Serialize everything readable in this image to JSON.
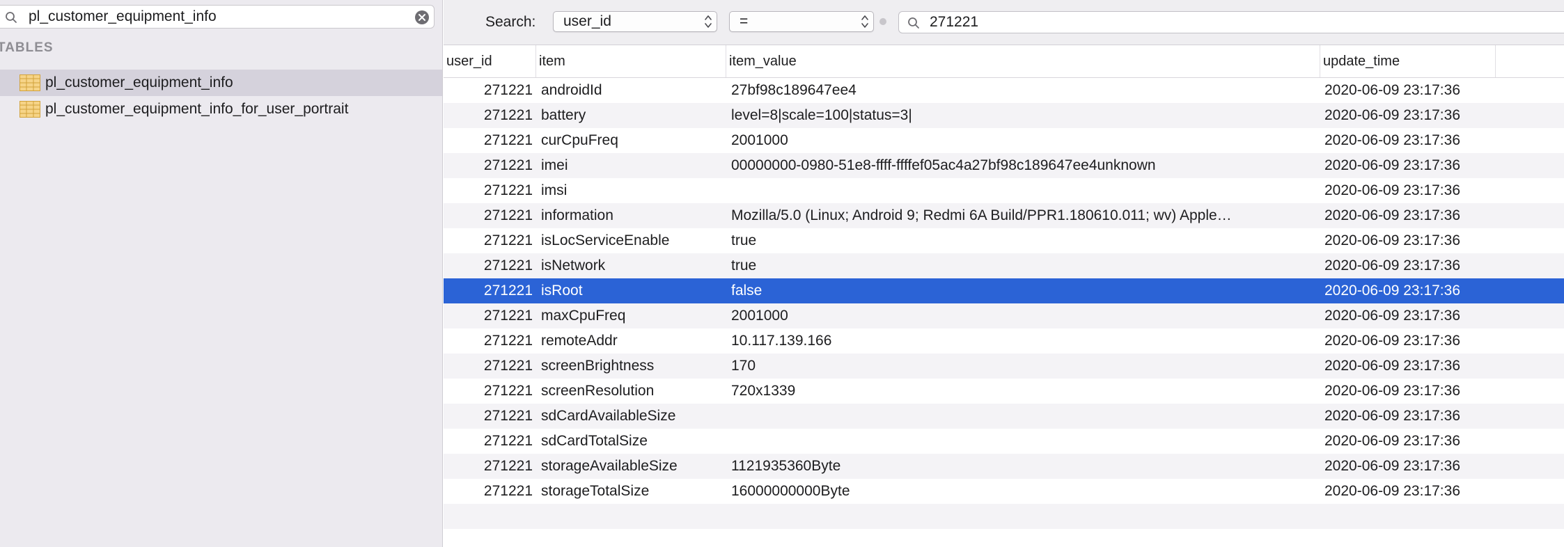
{
  "sidebar": {
    "search_value": "pl_customer_equipment_info",
    "section_title": "TABLES",
    "tables": [
      {
        "label": "pl_customer_equipment_info",
        "selected": true
      },
      {
        "label": "pl_customer_equipment_info_for_user_portrait",
        "selected": false
      }
    ]
  },
  "filter": {
    "label": "Search:",
    "field": "user_id",
    "operator": "=",
    "value": "271221"
  },
  "table": {
    "columns": [
      "user_id",
      "item",
      "item_value",
      "update_time"
    ],
    "selected_row_index": 8,
    "rows": [
      {
        "user_id": "271221",
        "item": "androidId",
        "item_value": "27bf98c189647ee4",
        "update_time": "2020-06-09 23:17:36"
      },
      {
        "user_id": "271221",
        "item": "battery",
        "item_value": "level=8|scale=100|status=3|",
        "update_time": "2020-06-09 23:17:36"
      },
      {
        "user_id": "271221",
        "item": "curCpuFreq",
        "item_value": "2001000",
        "update_time": "2020-06-09 23:17:36"
      },
      {
        "user_id": "271221",
        "item": "imei",
        "item_value": "00000000-0980-51e8-ffff-ffffef05ac4a27bf98c189647ee4unknown",
        "update_time": "2020-06-09 23:17:36"
      },
      {
        "user_id": "271221",
        "item": "imsi",
        "item_value": "",
        "update_time": "2020-06-09 23:17:36"
      },
      {
        "user_id": "271221",
        "item": "information",
        "item_value": "Mozilla/5.0 (Linux; Android 9; Redmi 6A Build/PPR1.180610.011; wv) Apple…",
        "update_time": "2020-06-09 23:17:36"
      },
      {
        "user_id": "271221",
        "item": "isLocServiceEnable",
        "item_value": "true",
        "update_time": "2020-06-09 23:17:36"
      },
      {
        "user_id": "271221",
        "item": "isNetwork",
        "item_value": "true",
        "update_time": "2020-06-09 23:17:36"
      },
      {
        "user_id": "271221",
        "item": "isRoot",
        "item_value": "false",
        "update_time": "2020-06-09 23:17:36"
      },
      {
        "user_id": "271221",
        "item": "maxCpuFreq",
        "item_value": "2001000",
        "update_time": "2020-06-09 23:17:36"
      },
      {
        "user_id": "271221",
        "item": "remoteAddr",
        "item_value": "10.117.139.166",
        "update_time": "2020-06-09 23:17:36"
      },
      {
        "user_id": "271221",
        "item": "screenBrightness",
        "item_value": "170",
        "update_time": "2020-06-09 23:17:36"
      },
      {
        "user_id": "271221",
        "item": "screenResolution",
        "item_value": "720x1339",
        "update_time": "2020-06-09 23:17:36"
      },
      {
        "user_id": "271221",
        "item": "sdCardAvailableSize",
        "item_value": "",
        "update_time": "2020-06-09 23:17:36"
      },
      {
        "user_id": "271221",
        "item": "sdCardTotalSize",
        "item_value": "",
        "update_time": "2020-06-09 23:17:36"
      },
      {
        "user_id": "271221",
        "item": "storageAvailableSize",
        "item_value": "1121935360Byte",
        "update_time": "2020-06-09 23:17:36"
      },
      {
        "user_id": "271221",
        "item": "storageTotalSize",
        "item_value": "16000000000Byte",
        "update_time": "2020-06-09 23:17:36"
      }
    ]
  }
}
